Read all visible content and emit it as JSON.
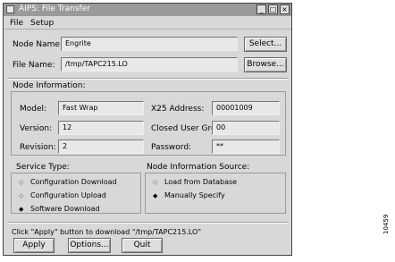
{
  "window": {
    "title": "AIPS: File Transfer",
    "controls": [
      "_",
      "□",
      "×"
    ]
  },
  "menu": [
    "File",
    "Setup"
  ],
  "node_name": {
    "label": "Node Name:",
    "value": "Engrite",
    "button": "Select..."
  },
  "file_name": {
    "label": "File Name:",
    "value": "/tmp/TAPC215.LO",
    "button": "Browse..."
  },
  "node_info": {
    "title": "Node Information:",
    "model": {
      "label": "Model:",
      "value": "Fast Wrap"
    },
    "version": {
      "label": "Version:",
      "value": "12"
    },
    "revision": {
      "label": "Revision:",
      "value": "2"
    },
    "x25_address": {
      "label": "X25 Address:",
      "value": "00001009"
    },
    "closed_user_group": {
      "label": "Closed User Group:",
      "value": "00"
    },
    "password": {
      "label": "Password:",
      "value": "**"
    }
  },
  "service_type": {
    "title": "Service Type:",
    "options": [
      "Configuration Download",
      "Configuration Upload",
      "Software Download"
    ],
    "selected": "Software Download"
  },
  "node_info_source": {
    "title": "Node Information Source:",
    "options": [
      "Load from Database",
      "Manually Specify"
    ],
    "selected": "Manually Specify"
  },
  "status_text": "Click \"Apply\" button to download \"/tmp/TAPC215.LO\"",
  "buttons": {
    "apply": "Apply",
    "options": "Options...",
    "quit": "Quit"
  },
  "figure_number": "10459"
}
